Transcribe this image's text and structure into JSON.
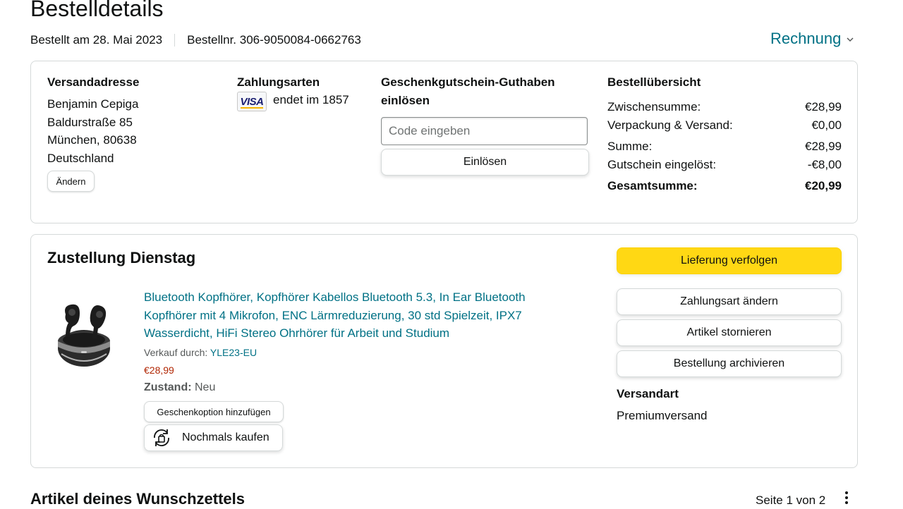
{
  "page": {
    "title": "Bestelldetails"
  },
  "order": {
    "date": "Bestellt am 28. Mai 2023",
    "number": "Bestellnr. 306-9050084-0662763",
    "invoice_label": "Rechnung"
  },
  "shipping_address": {
    "heading": "Versandadresse",
    "lines": [
      "Benjamin Cepiga",
      "Baldurstraße 85",
      "München, 80638",
      "Deutschland"
    ],
    "change_label": "Ändern"
  },
  "payment": {
    "heading": "Zahlungsarten",
    "card_brand": "VISA",
    "card_text": "endet im 1857"
  },
  "gift_card": {
    "heading_line1": "Geschenkgutschein-Guthaben",
    "heading_line2": "einlösen",
    "input_placeholder": "Code eingeben",
    "redeem_label": "Einlösen"
  },
  "summary": {
    "heading": "Bestellübersicht",
    "rows": [
      {
        "label": "Zwischensumme:",
        "value": "€28,99"
      },
      {
        "label": "Verpackung & Versand:",
        "value": "€0,00"
      },
      {
        "label": "Summe:",
        "value": "€28,99"
      },
      {
        "label": "Gutschein eingelöst:",
        "value": "-€8,00"
      },
      {
        "label": "Gesamtsumme:",
        "value": "€20,99"
      }
    ]
  },
  "delivery": {
    "heading": "Zustellung Dienstag",
    "product": {
      "title": "Bluetooth Kopfhörer, Kopfhörer Kabellos Bluetooth 5.3, In Ear Bluetooth Kopfhörer mit 4 Mikrofon, ENC Lärmreduzierung, 30 std Spielzeit, IPX7 Wasserdicht, HiFi Stereo Ohrhörer für Arbeit und Studium",
      "sold_by_label": "Verkauf durch:",
      "seller": "YLE23-EU",
      "price": "€28,99",
      "condition_label": "Zustand:",
      "condition_value": "Neu",
      "gift_option_label": "Geschenkoption hinzufügen",
      "buy_again_label": "Nochmals kaufen"
    },
    "actions": {
      "track_label": "Lieferung verfolgen",
      "change_payment_label": "Zahlungsart ändern",
      "cancel_label": "Artikel stornieren",
      "archive_label": "Bestellung archivieren"
    },
    "shipping_method_heading": "Versandart",
    "shipping_method_value": "Premiumversand"
  },
  "wishlist": {
    "heading": "Artikel deines Wunschzettels",
    "pager": "Seite 1 von 2"
  },
  "colors": {
    "link": "#007185",
    "price": "#B12704",
    "track_button": "#FFD814",
    "border": "#D5D9D9"
  }
}
